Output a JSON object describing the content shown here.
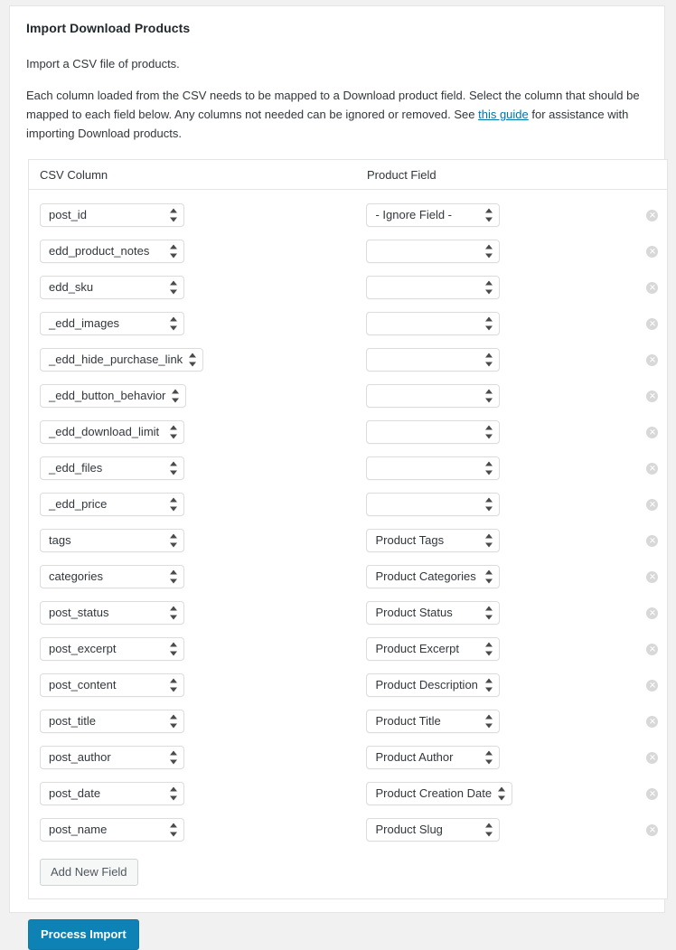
{
  "page": {
    "title": "Import Download Products",
    "intro_line": "Import a CSV file of products.",
    "intro_before_link": "Each column loaded from the CSV needs to be mapped to a Download product field. Select the column that should be mapped to each field below. Any columns not needed can be ignored or removed. See ",
    "link_text": "this guide",
    "intro_after_link": " for assistance with importing Download products."
  },
  "table": {
    "headers": {
      "csv_column": "CSV Column",
      "product_field": "Product Field"
    },
    "remove_icon": "remove-circle-icon",
    "rows": [
      {
        "csv": "post_id",
        "field": "- Ignore Field -"
      },
      {
        "csv": "edd_product_notes",
        "field": ""
      },
      {
        "csv": "edd_sku",
        "field": ""
      },
      {
        "csv": "_edd_images",
        "field": ""
      },
      {
        "csv": "_edd_hide_purchase_link",
        "field": ""
      },
      {
        "csv": "_edd_button_behavior",
        "field": ""
      },
      {
        "csv": "_edd_download_limit",
        "field": ""
      },
      {
        "csv": "_edd_files",
        "field": ""
      },
      {
        "csv": "_edd_price",
        "field": ""
      },
      {
        "csv": "tags",
        "field": "Product Tags"
      },
      {
        "csv": "categories",
        "field": "Product Categories"
      },
      {
        "csv": "post_status",
        "field": "Product Status"
      },
      {
        "csv": "post_excerpt",
        "field": "Product Excerpt"
      },
      {
        "csv": "post_content",
        "field": "Product Description"
      },
      {
        "csv": "post_title",
        "field": "Product Title"
      },
      {
        "csv": "post_author",
        "field": "Product Author"
      },
      {
        "csv": "post_date",
        "field": "Product Creation Date"
      },
      {
        "csv": "post_name",
        "field": "Product Slug"
      }
    ]
  },
  "actions": {
    "add_new_field": "Add New Field",
    "process_import": "Process Import"
  },
  "colors": {
    "primary_button": "#0e82b4",
    "link": "#0073aa",
    "title_text": "#23282d",
    "page_background": "#f1f1f1"
  }
}
